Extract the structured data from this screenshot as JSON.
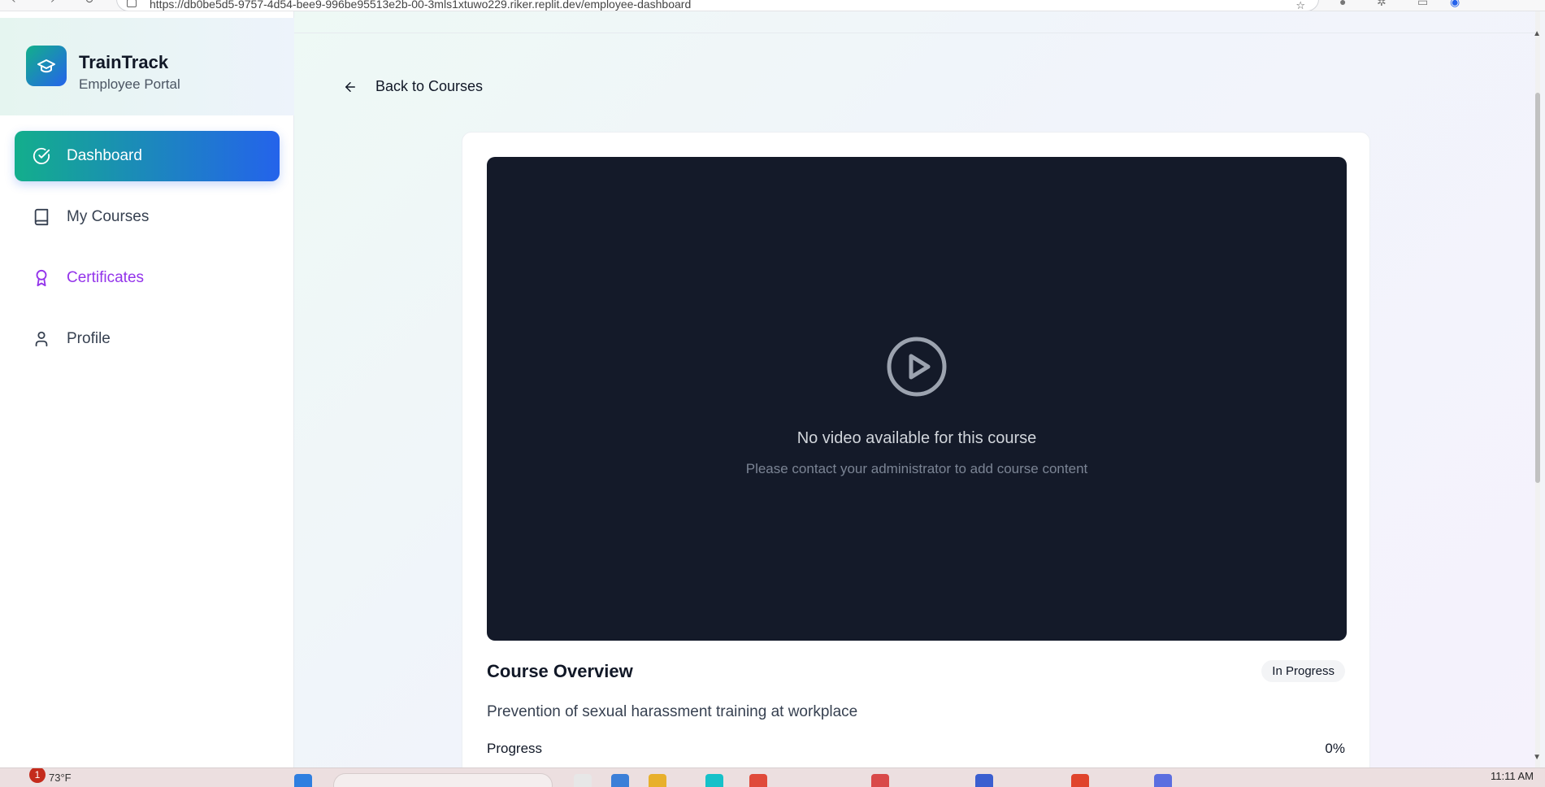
{
  "browser": {
    "url": "https://db0be5d5-9757-4d54-bee9-996be95513e2b-00-3mls1xtuwo229.riker.replit.dev/employee-dashboard"
  },
  "sidebar": {
    "brand_title": "TrainTrack",
    "brand_subtitle": "Employee Portal",
    "items": [
      {
        "label": "Dashboard",
        "icon": "check-circle-icon",
        "active": true
      },
      {
        "label": "My Courses",
        "icon": "book-icon"
      },
      {
        "label": "Certificates",
        "icon": "award-icon",
        "color": "#9333ea"
      },
      {
        "label": "Profile",
        "icon": "user-icon"
      }
    ]
  },
  "main": {
    "back_label": "Back to Courses",
    "video": {
      "message": "No video available for this course",
      "submessage": "Please contact your administrator to add course content"
    },
    "overview_title": "Course Overview",
    "status": "In Progress",
    "description": "Prevention of sexual harassment training at workplace",
    "progress_label": "Progress",
    "progress_value": "0%"
  },
  "taskbar": {
    "weather": "73°F",
    "notification_count": "1",
    "time": "11:11 AM"
  },
  "colors": {
    "accent_green": "#13ae8c",
    "accent_blue": "#2463eb",
    "certificates_purple": "#9333ea",
    "video_bg": "#141a29"
  }
}
